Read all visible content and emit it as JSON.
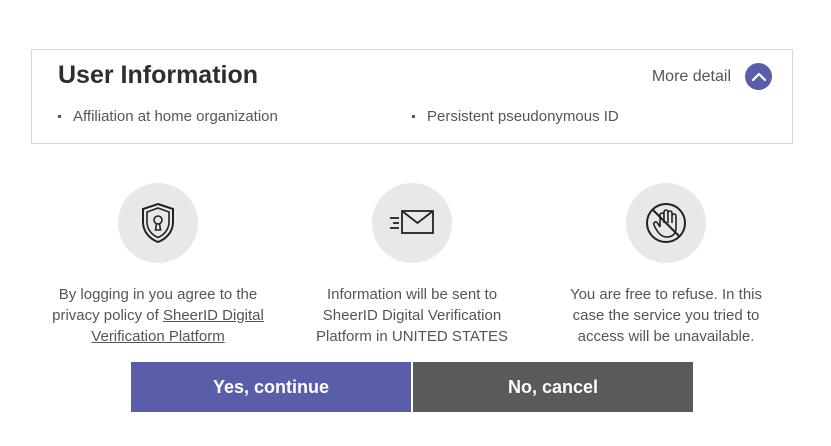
{
  "user_info": {
    "title": "User Information",
    "more_detail_label": "More detail",
    "attributes": [
      "Affiliation at home organization",
      "Persistent pseudonymous ID"
    ]
  },
  "features": [
    {
      "icon": "shield-keyhole-icon",
      "text_before": "By logging in you agree to the privacy policy of ",
      "link_text": "SheerID Digital Verification Platform"
    },
    {
      "icon": "envelope-send-icon",
      "text": "Information will be sent to SheerID Digital Verification Platform in UNITED STATES"
    },
    {
      "icon": "no-hand-icon",
      "text": "You are free to refuse. In this case the service you tried to access will be unavailable."
    }
  ],
  "buttons": {
    "yes_label": "Yes, continue",
    "no_label": "No, cancel"
  },
  "colors": {
    "accent": "#5a5ea9",
    "cancel": "#5a5a5a",
    "icon_bg": "#e8e8e8"
  }
}
